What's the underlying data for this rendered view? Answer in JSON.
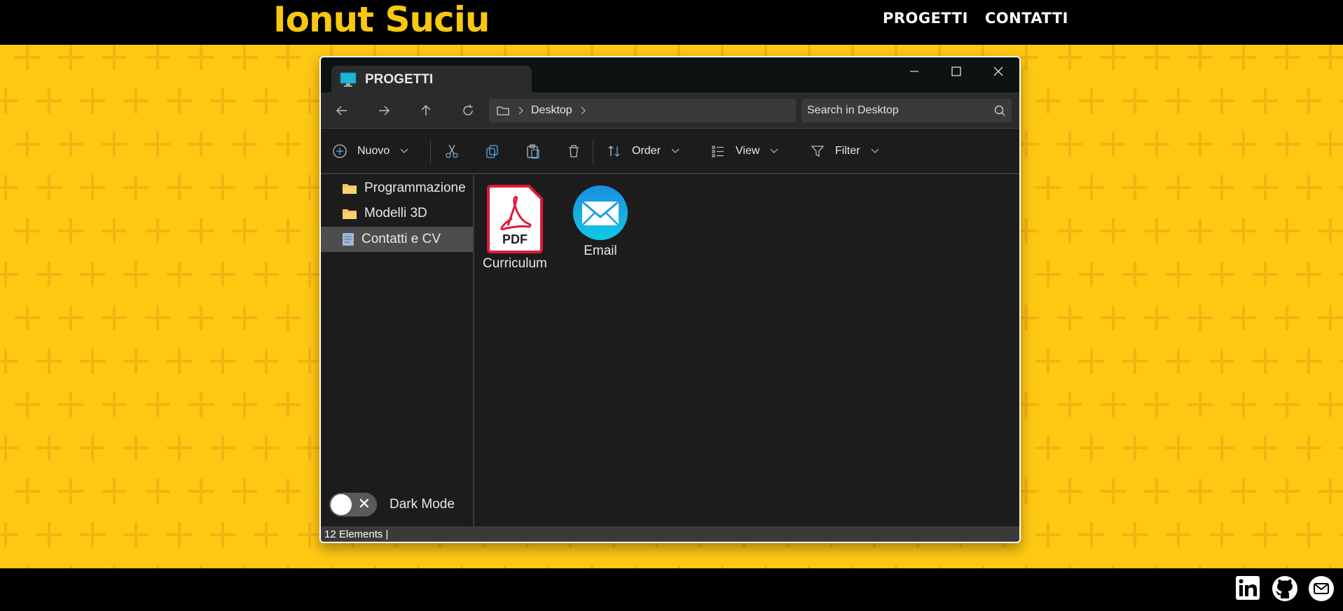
{
  "site": {
    "brand": "Ionut Suciu",
    "nav": [
      "PROGETTI",
      "CONTATTI"
    ],
    "social": [
      "linkedin-icon",
      "github-icon",
      "mail-icon"
    ],
    "accent": "#f9c80e"
  },
  "window": {
    "tab_title": "PROGETTI",
    "breadcrumb": "Desktop",
    "search_placeholder": "Search in Desktop",
    "toolbar": {
      "new_label": "Nuovo",
      "order_label": "Order",
      "view_label": "View",
      "filter_label": "Filter"
    },
    "sidebar": [
      {
        "label": "Programmazione",
        "icon": "folder-icon"
      },
      {
        "label": "Modelli 3D",
        "icon": "folder-icon"
      },
      {
        "label": "Contatti e CV",
        "icon": "document-icon",
        "selected": true
      }
    ],
    "files": [
      {
        "label": "Curriculum",
        "icon": "pdf-icon",
        "badge": "PDF"
      },
      {
        "label": "Email",
        "icon": "mail-icon"
      }
    ],
    "dark_mode_label": "Dark Mode",
    "status": "12 Elements |"
  }
}
